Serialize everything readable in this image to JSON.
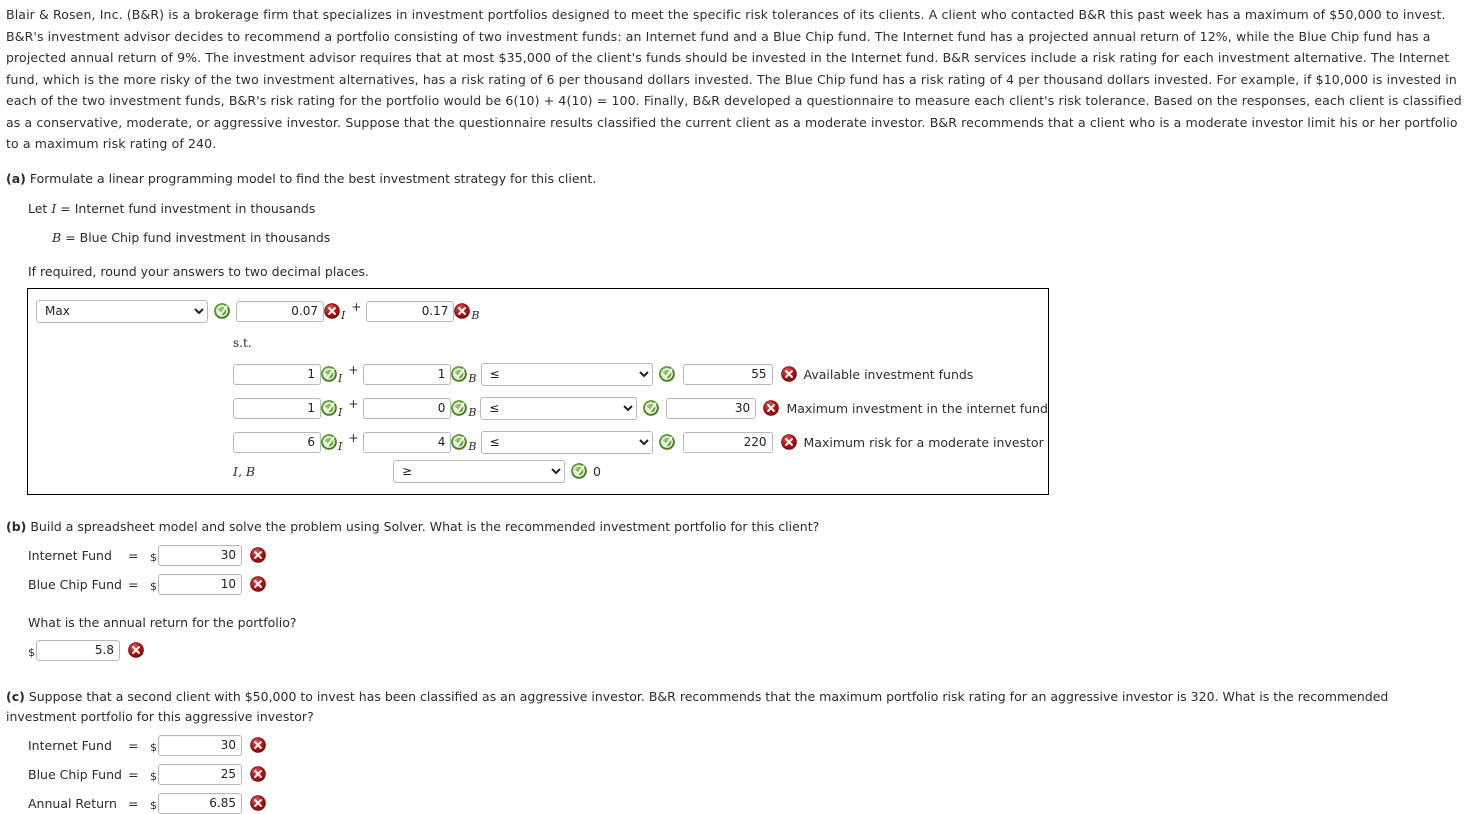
{
  "intro": {
    "paragraph": "Blair & Rosen, Inc. (B&R) is a brokerage firm that specializes in investment portfolios designed to meet the specific risk tolerances of its clients. A client who contacted B&R this past week has a maximum of $50,000 to invest. B&R's investment advisor decides to recommend a portfolio consisting of two investment funds: an Internet fund and a Blue Chip fund. The Internet fund has a projected annual return of 12%, while the Blue Chip fund has a projected annual return of 9%. The investment advisor requires that at most $35,000 of the client's funds should be invested in the Internet fund. B&R services include a risk rating for each investment alternative. The Internet fund, which is the more risky of the two investment alternatives, has a risk rating of 6 per thousand dollars invested. The Blue Chip fund has a risk rating of 4 per thousand dollars invested. For example, if $10,000 is invested in each of the two investment funds, B&R's risk rating for the portfolio would be 6(10) + 4(10) = 100. Finally, B&R developed a questionnaire to measure each client's risk tolerance. Based on the responses, each client is classified as a conservative, moderate, or aggressive investor. Suppose that the questionnaire results classified the current client as a moderate investor. B&R recommends that a client who is a moderate investor limit his or her portfolio to a maximum risk rating of 240."
  },
  "parts": {
    "a": {
      "label": "(a)",
      "text": "Formulate a linear programming model to find the best investment strategy for this client.",
      "let_prefix": "Let",
      "var_i": "I",
      "var_i_def": "= Internet fund investment in thousands",
      "var_b": "B",
      "var_b_def": "= Blue Chip fund investment in thousands",
      "rounding_note": "If required, round your answers to two decimal places."
    },
    "b": {
      "label": "(b)",
      "text": "Build a spreadsheet model and solve the problem using Solver. What is the recommended investment portfolio for this client?",
      "question": "What is the annual return for the portfolio?",
      "rows": [
        {
          "label": "Internet Fund",
          "eq": "=",
          "currency": "$",
          "value": "30",
          "status": "incorrect"
        },
        {
          "label": "Blue Chip Fund",
          "eq": "=",
          "currency": "$",
          "value": "10",
          "status": "incorrect"
        }
      ],
      "return_row": {
        "currency": "$",
        "value": "5.8",
        "status": "incorrect"
      }
    },
    "c": {
      "label": "(c)",
      "text": "Suppose that a second client with $50,000 to invest has been classified as an aggressive investor. B&R recommends that the maximum portfolio risk rating for an aggressive investor is 320. What is the recommended investment portfolio for this aggressive investor?",
      "rows": [
        {
          "label": "Internet Fund",
          "eq": "=",
          "currency": "$",
          "value": "30",
          "status": "incorrect"
        },
        {
          "label": "Blue Chip Fund",
          "eq": "=",
          "currency": "$",
          "value": "25",
          "status": "incorrect"
        },
        {
          "label": "Annual Return",
          "eq": "=",
          "currency": "$",
          "value": "6.85",
          "status": "incorrect"
        }
      ]
    }
  },
  "model": {
    "objective": {
      "direction_selected": "Max",
      "direction_options": [
        "Max",
        "Min"
      ],
      "direction_status": "correct",
      "coef_i": "0.07",
      "coef_i_status": "incorrect",
      "var_i": "I",
      "operator": "+",
      "coef_b": "0.17",
      "coef_b_status": "incorrect",
      "var_b": "B"
    },
    "subject_to": "s.t.",
    "constraints": [
      {
        "coef_i": "1",
        "coef_i_status": "correct",
        "var_i": "I",
        "operator": "+",
        "coef_b": "1",
        "coef_b_status": "correct",
        "var_b": "B",
        "relation_selected": "≤",
        "relation_options": [
          "≤",
          "=",
          "≥"
        ],
        "relation_status": "correct",
        "rhs": "55",
        "rhs_status": "incorrect",
        "label": "Available investment funds"
      },
      {
        "coef_i": "1",
        "coef_i_status": "correct",
        "var_i": "I",
        "operator": "+",
        "coef_b": "0",
        "coef_b_status": "correct",
        "var_b": "B",
        "relation_selected": "≤",
        "relation_options": [
          "≤",
          "=",
          "≥"
        ],
        "relation_status": "correct",
        "rhs": "30",
        "rhs_status": "incorrect",
        "label": "Maximum investment in the internet fund"
      },
      {
        "coef_i": "6",
        "coef_i_status": "correct",
        "var_i": "I",
        "operator": "+",
        "coef_b": "4",
        "coef_b_status": "correct",
        "var_b": "B",
        "relation_selected": "≤",
        "relation_options": [
          "≤",
          "=",
          "≥"
        ],
        "relation_status": "correct",
        "rhs": "220",
        "rhs_status": "incorrect",
        "label": "Maximum risk for a moderate investor"
      }
    ],
    "nonnegativity": {
      "vars": "I, B",
      "relation_selected": "≥",
      "relation_options": [
        "≤",
        "=",
        "≥"
      ],
      "relation_status": "correct",
      "rhs": "0"
    }
  },
  "colors": {
    "correct_green": "#4c9a2a",
    "incorrect_red": "#b01515",
    "box_border": "#000000",
    "text": "#2e2e2e"
  }
}
